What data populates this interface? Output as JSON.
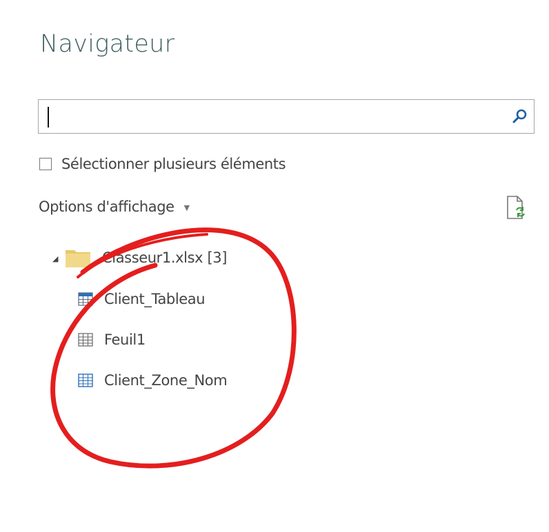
{
  "navigator": {
    "title": "Navigateur",
    "search": {
      "value": "",
      "placeholder": ""
    },
    "multi_select_label": "Sélectionner plusieurs éléments",
    "view_options_label": "Options d'affichage",
    "tree": {
      "root": {
        "label": "Classeur1.xlsx [3]",
        "expanded": true
      },
      "items": [
        {
          "label": "Client_Tableau",
          "icon": "table-icon"
        },
        {
          "label": "Feuil1",
          "icon": "sheet-icon"
        },
        {
          "label": "Client_Zone_Nom",
          "icon": "named-range-icon"
        }
      ]
    }
  },
  "colors": {
    "title": "#3f5f5f",
    "text": "#444444",
    "search_icon": "#1f5f9f",
    "folder": "#e8c96a",
    "annotation": "#e41e1e"
  }
}
